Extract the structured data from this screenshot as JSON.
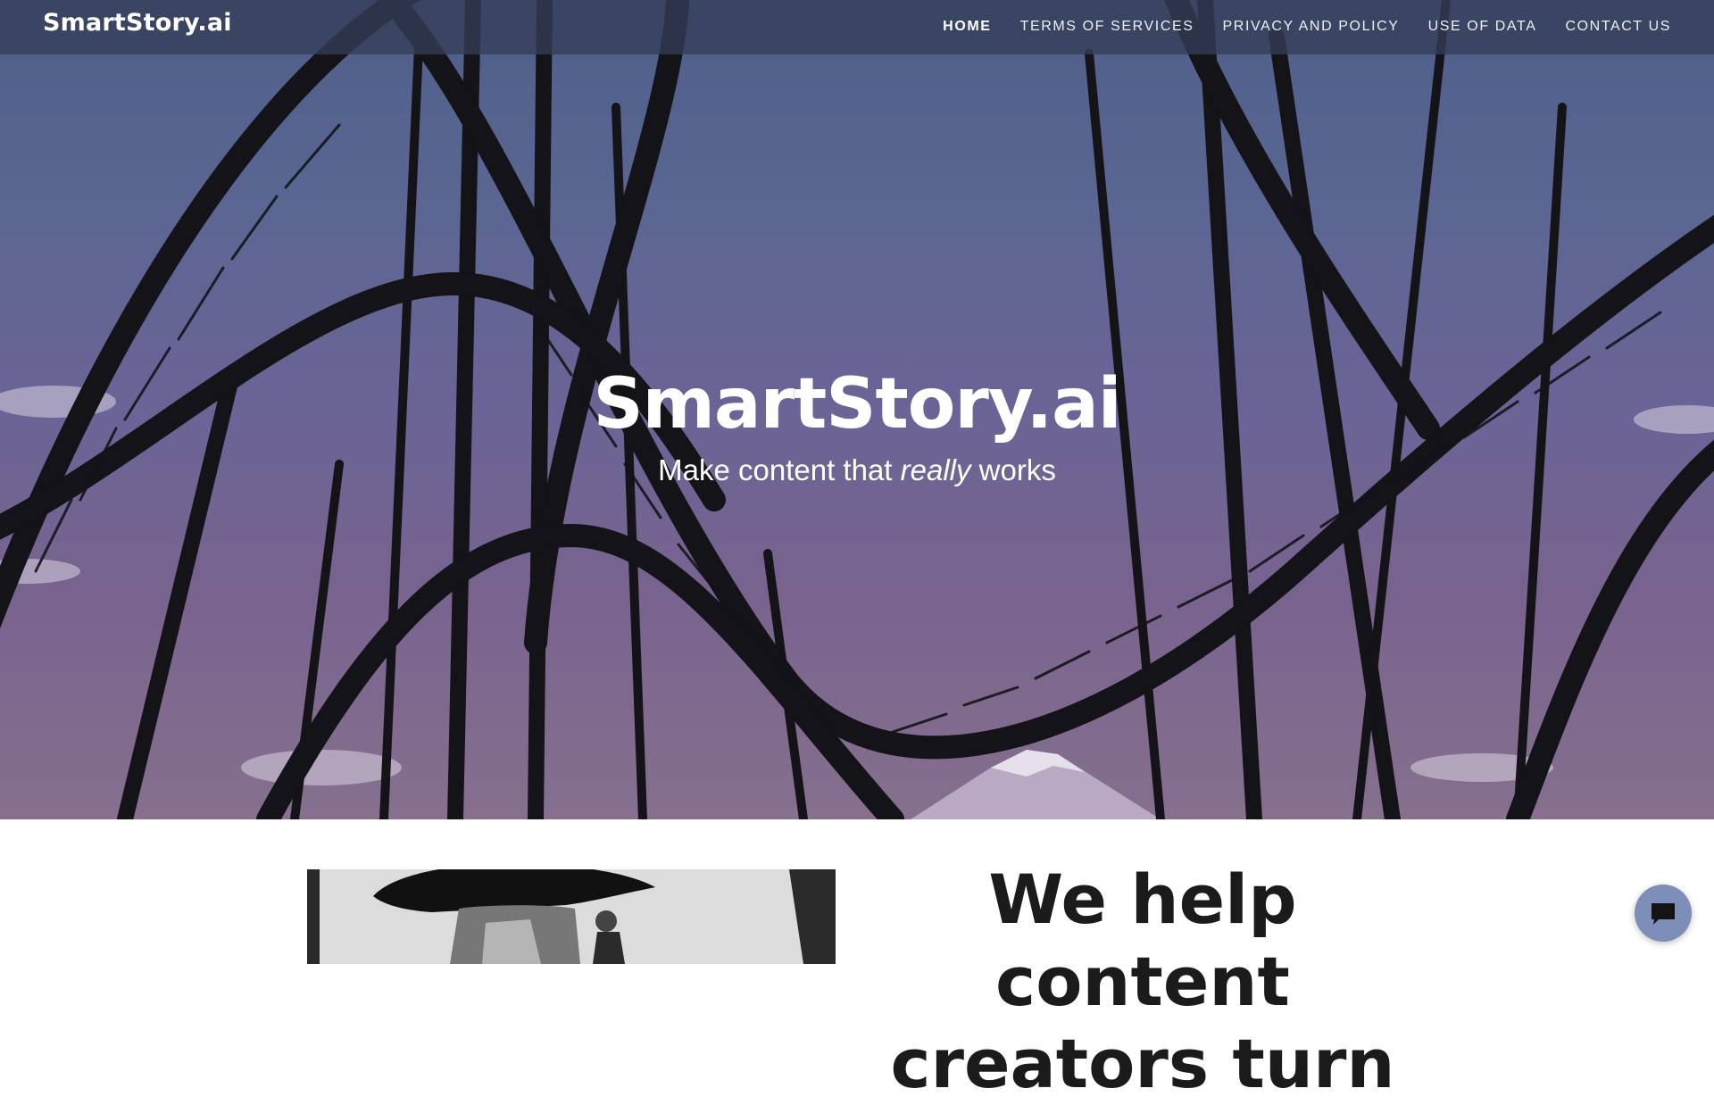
{
  "site": {
    "logo": "SmartStory.ai"
  },
  "nav": {
    "items": [
      {
        "label": "HOME",
        "active": true
      },
      {
        "label": "TERMS OF SERVICES",
        "active": false
      },
      {
        "label": "PRIVACY AND POLICY",
        "active": false
      },
      {
        "label": "USE OF DATA",
        "active": false
      },
      {
        "label": "CONTACT US",
        "active": false
      }
    ]
  },
  "hero": {
    "title": "SmartStory.ai",
    "subtitle_before": "Make content that ",
    "subtitle_emphasis": "really",
    "subtitle_after": " works",
    "background": "roller-coaster-photo"
  },
  "section": {
    "heading": "We help content creators turn"
  },
  "chat": {
    "icon": "chat-bubble-icon"
  },
  "colors": {
    "nav_bg": "#343e58",
    "chat_bg": "#7d8fb8",
    "heading": "#1b1b1b"
  }
}
